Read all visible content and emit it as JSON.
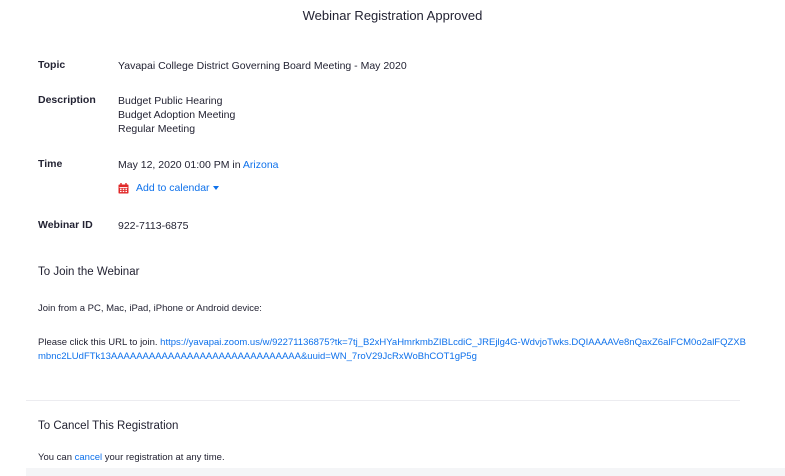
{
  "page": {
    "title": "Webinar Registration Approved"
  },
  "details": {
    "topic_label": "Topic",
    "topic_value": "Yavapai College District Governing Board Meeting - May 2020",
    "description_label": "Description",
    "description_lines": [
      "Budget Public Hearing",
      "Budget Adoption Meeting",
      "Regular Meeting"
    ],
    "time_label": "Time",
    "time_value": "May 12, 2020 01:00 PM in",
    "time_zone_link": "Arizona",
    "add_to_calendar_label": "Add to calendar",
    "calendar_icon": "calendar-icon",
    "webinar_id_label": "Webinar ID",
    "webinar_id_value": "922-7113-6875"
  },
  "join": {
    "heading": "To Join the Webinar",
    "devices_text": "Join from a PC, Mac, iPad, iPhone or Android device:",
    "url_prompt": "Please click this URL to join.",
    "url": "https://yavapai.zoom.us/w/92271136875?tk=7tj_B2xHYaHmrkmbZIBLcdiC_JREjlg4G-WdvjoTwks.DQIAAAAVe8nQaxZ6alFCM0o2alFQZXBmbnc2LUdFTk13AAAAAAAAAAAAAAAAAAAAAAAAAAAAAA&uuid=WN_7roV29JcRxWoBhCOT1gP5g"
  },
  "cancel": {
    "heading": "To Cancel This Registration",
    "text_before": "You can",
    "link_label": "cancel",
    "text_after": "your registration at any time."
  },
  "colors": {
    "link": "#0e71eb",
    "text": "#232333",
    "calendar_icon": "#e02828"
  }
}
